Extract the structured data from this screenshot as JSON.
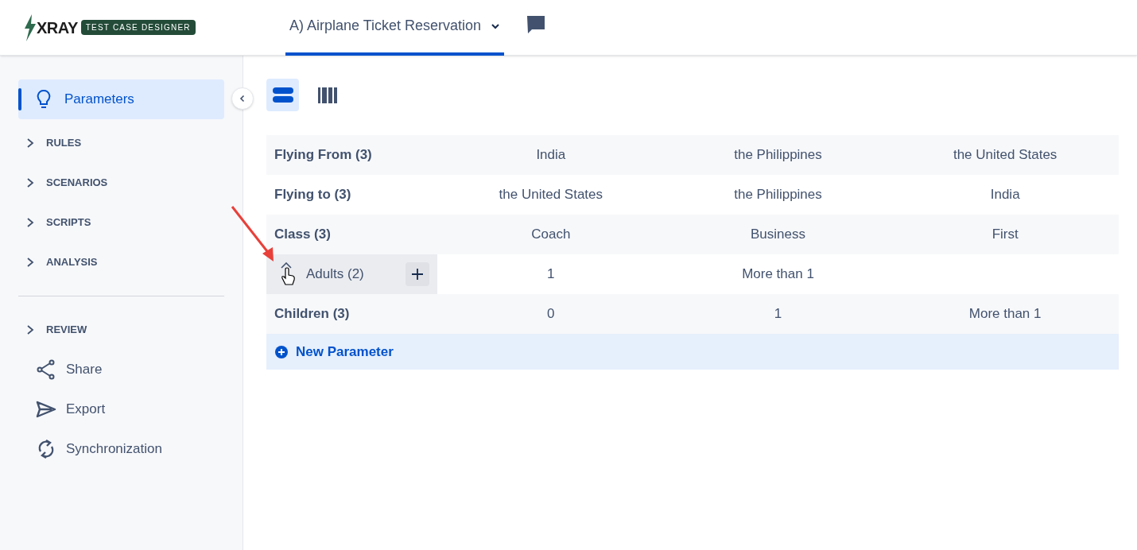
{
  "app": {
    "logo_word": "XRAY",
    "logo_tag": "TEST CASE DESIGNER"
  },
  "project_tab": {
    "label": "A) Airplane Ticket Reservation",
    "selected": true
  },
  "sidebar": {
    "items": [
      {
        "kind": "page",
        "label": "Parameters",
        "selected": true
      },
      {
        "kind": "section",
        "label": "RULES",
        "expanded": false
      },
      {
        "kind": "section",
        "label": "SCENARIOS",
        "expanded": false
      },
      {
        "kind": "section",
        "label": "SCRIPTS",
        "expanded": false
      },
      {
        "kind": "section",
        "label": "ANALYSIS",
        "expanded": false
      },
      {
        "kind": "divider"
      },
      {
        "kind": "section",
        "label": "REVIEW",
        "expanded": false
      },
      {
        "kind": "action",
        "label": "Share"
      },
      {
        "kind": "action",
        "label": "Export"
      },
      {
        "kind": "action",
        "label": "Synchronization"
      }
    ]
  },
  "views": [
    {
      "selected": true
    },
    {
      "selected": false
    }
  ],
  "parameters": [
    {
      "name": "Flying From (3)",
      "values": [
        "India",
        "the Philippines",
        "the United States"
      ],
      "hovered": false
    },
    {
      "name": "Flying to (3)",
      "values": [
        "the United States",
        "the Philippines",
        "India"
      ],
      "hovered": false
    },
    {
      "name": "Class (3)",
      "values": [
        "Coach",
        "Business",
        "First"
      ],
      "hovered": false
    },
    {
      "name": "Adults (2)",
      "values": [
        "1",
        "More than 1"
      ],
      "hovered": true
    },
    {
      "name": "Children (3)",
      "values": [
        "0",
        "1",
        "More than 1"
      ],
      "hovered": false
    }
  ],
  "new_parameter": "New Parameter"
}
